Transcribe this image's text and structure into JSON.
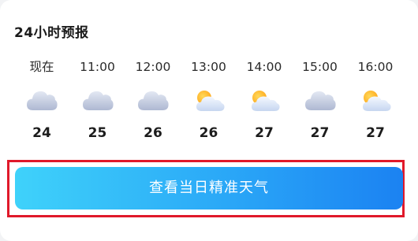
{
  "forecast": {
    "title": "24小时预报",
    "hours": [
      {
        "time": "现在",
        "icon": "cloudy-icon",
        "temp": "24"
      },
      {
        "time": "11:00",
        "icon": "cloudy-icon",
        "temp": "25"
      },
      {
        "time": "12:00",
        "icon": "cloudy-icon",
        "temp": "26"
      },
      {
        "time": "13:00",
        "icon": "partly-cloudy-icon",
        "temp": "26"
      },
      {
        "time": "14:00",
        "icon": "partly-cloudy-icon",
        "temp": "27"
      },
      {
        "time": "15:00",
        "icon": "cloudy-icon",
        "temp": "27"
      },
      {
        "time": "16:00",
        "icon": "partly-cloudy-icon",
        "temp": "27"
      }
    ]
  },
  "action": {
    "label": "查看当日精准天气"
  },
  "colors": {
    "highlight_border": "#e0192a",
    "button_gradient_start": "#3fd2fa",
    "button_gradient_end": "#1b82f2",
    "cloud": "#b9c2d9",
    "sun": "#ffbe2e"
  }
}
